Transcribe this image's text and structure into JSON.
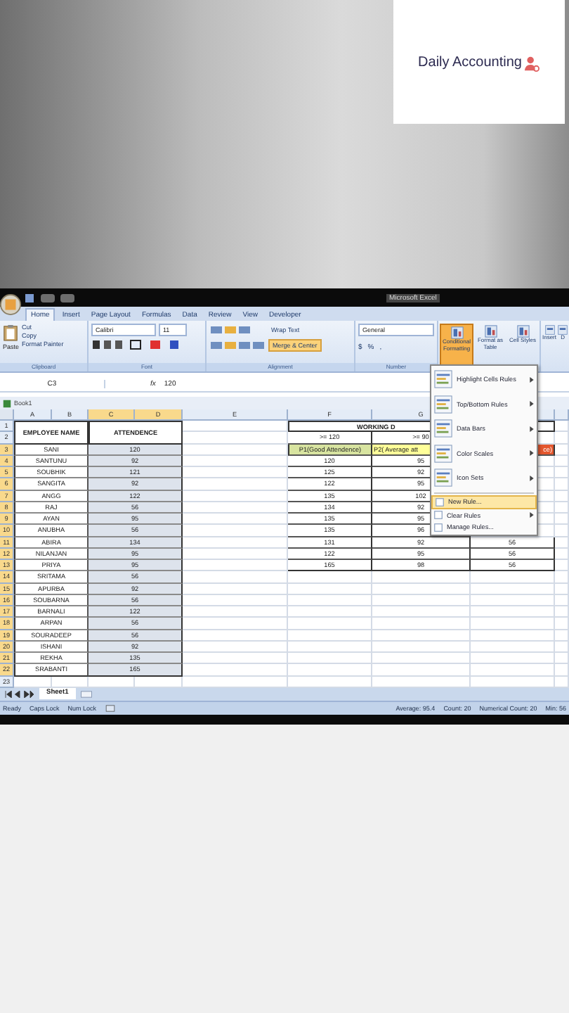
{
  "logo": {
    "text": "Daily Accounting"
  },
  "window": {
    "title": "Microsoft Excel"
  },
  "ribbon": {
    "tabs": [
      {
        "label": "Home",
        "selected": true
      },
      {
        "label": "Insert",
        "selected": false
      },
      {
        "label": "Page Layout",
        "selected": false
      },
      {
        "label": "Formulas",
        "selected": false
      },
      {
        "label": "Data",
        "selected": false
      },
      {
        "label": "Review",
        "selected": false
      },
      {
        "label": "View",
        "selected": false
      },
      {
        "label": "Developer",
        "selected": false
      }
    ],
    "clipboard": {
      "label": "Clipboard",
      "paste": "Paste",
      "commands": [
        "Cut",
        "Copy",
        "Format Painter"
      ]
    },
    "font": {
      "label": "Font",
      "name": "Calibri",
      "size": "11"
    },
    "alignment": {
      "label": "Alignment",
      "commands": [
        {
          "label": "Wrap Text",
          "active": false
        },
        {
          "label": "Merge & Center",
          "active": true
        }
      ]
    },
    "number": {
      "label": "Number",
      "format": "General",
      "symbols": [
        "$",
        "%",
        ","
      ]
    },
    "styles": {
      "commands": [
        {
          "label": "Conditional Formatting",
          "active": true
        },
        {
          "label": "Format as Table",
          "active": false
        },
        {
          "label": "Cell Styles",
          "active": false
        }
      ]
    },
    "cells": {
      "commands": [
        "Insert",
        "D"
      ]
    }
  },
  "formula_bar": {
    "name_box": "C3",
    "fx": "fx",
    "value": "120"
  },
  "workbook": {
    "title": "Book1"
  },
  "sheet": {
    "columns": [
      {
        "label": "A",
        "selected": false
      },
      {
        "label": "B",
        "selected": false
      },
      {
        "label": "C",
        "selected": true
      },
      {
        "label": "D",
        "selected": true
      },
      {
        "label": "E",
        "selected": false
      },
      {
        "label": "F",
        "selected": false
      },
      {
        "label": "G",
        "selected": false
      }
    ],
    "row_headers": [
      {
        "label": "1",
        "selected": false
      },
      {
        "label": "2",
        "selected": false
      },
      {
        "label": "3",
        "selected": true
      },
      {
        "label": "4",
        "selected": true
      },
      {
        "label": "5",
        "selected": true
      },
      {
        "label": "6",
        "selected": true
      },
      {
        "label": "7",
        "selected": true
      },
      {
        "label": "8",
        "selected": true
      },
      {
        "label": "9",
        "selected": true
      },
      {
        "label": "10",
        "selected": true
      },
      {
        "label": "11",
        "selected": true
      },
      {
        "label": "12",
        "selected": true
      },
      {
        "label": "13",
        "selected": true
      },
      {
        "label": "14",
        "selected": true
      },
      {
        "label": "15",
        "selected": true
      },
      {
        "label": "16",
        "selected": true
      },
      {
        "label": "17",
        "selected": true
      },
      {
        "label": "18",
        "selected": true
      },
      {
        "label": "19",
        "selected": true
      },
      {
        "label": "20",
        "selected": true
      },
      {
        "label": "21",
        "selected": true
      },
      {
        "label": "22",
        "selected": true
      },
      {
        "label": "23",
        "selected": false
      }
    ]
  },
  "employees": {
    "headers": [
      "EMPLOYEE NAME",
      "ATTENDENCE"
    ],
    "rows": [
      {
        "name": "SANI",
        "attendance": "120"
      },
      {
        "name": "SANTUNU",
        "attendance": "92"
      },
      {
        "name": "SOUBHIK",
        "attendance": "121"
      },
      {
        "name": "SANGITA",
        "attendance": "92"
      },
      {
        "name": "ANGG",
        "attendance": "122"
      },
      {
        "name": "RAJ",
        "attendance": "56"
      },
      {
        "name": "AYAN",
        "attendance": "95"
      },
      {
        "name": "ANUBHA",
        "attendance": "56"
      },
      {
        "name": "ABIRA",
        "attendance": "134"
      },
      {
        "name": "NILANJAN",
        "attendance": "95"
      },
      {
        "name": "PRIYA",
        "attendance": "95"
      },
      {
        "name": "SRITAMA",
        "attendance": "56"
      },
      {
        "name": "APURBA",
        "attendance": "92"
      },
      {
        "name": "SOUBARNA",
        "attendance": "56"
      },
      {
        "name": "BARNALI",
        "attendance": "122"
      },
      {
        "name": "ARPAN",
        "attendance": "56"
      },
      {
        "name": "SOURADEEP",
        "attendance": "56"
      },
      {
        "name": "ISHANI",
        "attendance": "92"
      },
      {
        "name": "REKHA",
        "attendance": "135"
      },
      {
        "name": "SRABANTI",
        "attendance": "165"
      }
    ]
  },
  "criteria": {
    "title": "WORKING D",
    "thresholds": [
      ">= 120",
      ">= 90"
    ],
    "categories": [
      {
        "label": "P1(Good Attendence)",
        "color": "#d8e4a0"
      },
      {
        "label": "P2( Average att",
        "color": "#ffff99"
      },
      {
        "label": "ce)",
        "color": "#e4572e"
      }
    ],
    "rows": [
      {
        "p1": "120",
        "p2": "95"
      },
      {
        "p1": "125",
        "p2": "92"
      },
      {
        "p1": "122",
        "p2": "95"
      },
      {
        "p1": "135",
        "p2": "102"
      },
      {
        "p1": "134",
        "p2": "92"
      },
      {
        "p1": "135",
        "p2": "95"
      },
      {
        "p1": "135",
        "p2": "96"
      },
      {
        "p1": "131",
        "p2": "92",
        "p3": "56"
      },
      {
        "p1": "122",
        "p2": "95",
        "p3": "56"
      },
      {
        "p1": "165",
        "p2": "98",
        "p3": "56"
      }
    ]
  },
  "menu": {
    "items": [
      {
        "label": "Highlight Cells Rules",
        "kind": "large",
        "submenu": true,
        "highlighted": false
      },
      {
        "label": "Top/Bottom Rules",
        "kind": "large",
        "submenu": true,
        "highlighted": false
      },
      {
        "label": "Data Bars",
        "kind": "large",
        "submenu": true,
        "highlighted": false
      },
      {
        "label": "Color Scales",
        "kind": "large",
        "submenu": true,
        "highlighted": false
      },
      {
        "label": "Icon Sets",
        "kind": "large",
        "submenu": true,
        "highlighted": false
      },
      {
        "label": "New Rule...",
        "kind": "small",
        "submenu": false,
        "highlighted": true
      },
      {
        "label": "Clear Rules",
        "kind": "small",
        "submenu": true,
        "highlighted": false
      },
      {
        "label": "Manage Rules...",
        "kind": "small",
        "submenu": false,
        "highlighted": false
      }
    ]
  },
  "sheet_tabs": [
    {
      "label": "Sheet1",
      "selected": true
    }
  ],
  "status_bar": {
    "items": [
      "Ready",
      "Caps Lock",
      "Num Lock"
    ],
    "stats": [
      "Average: 95.4",
      "Count: 20",
      "Numerical Count: 20",
      "Min: 56"
    ]
  }
}
